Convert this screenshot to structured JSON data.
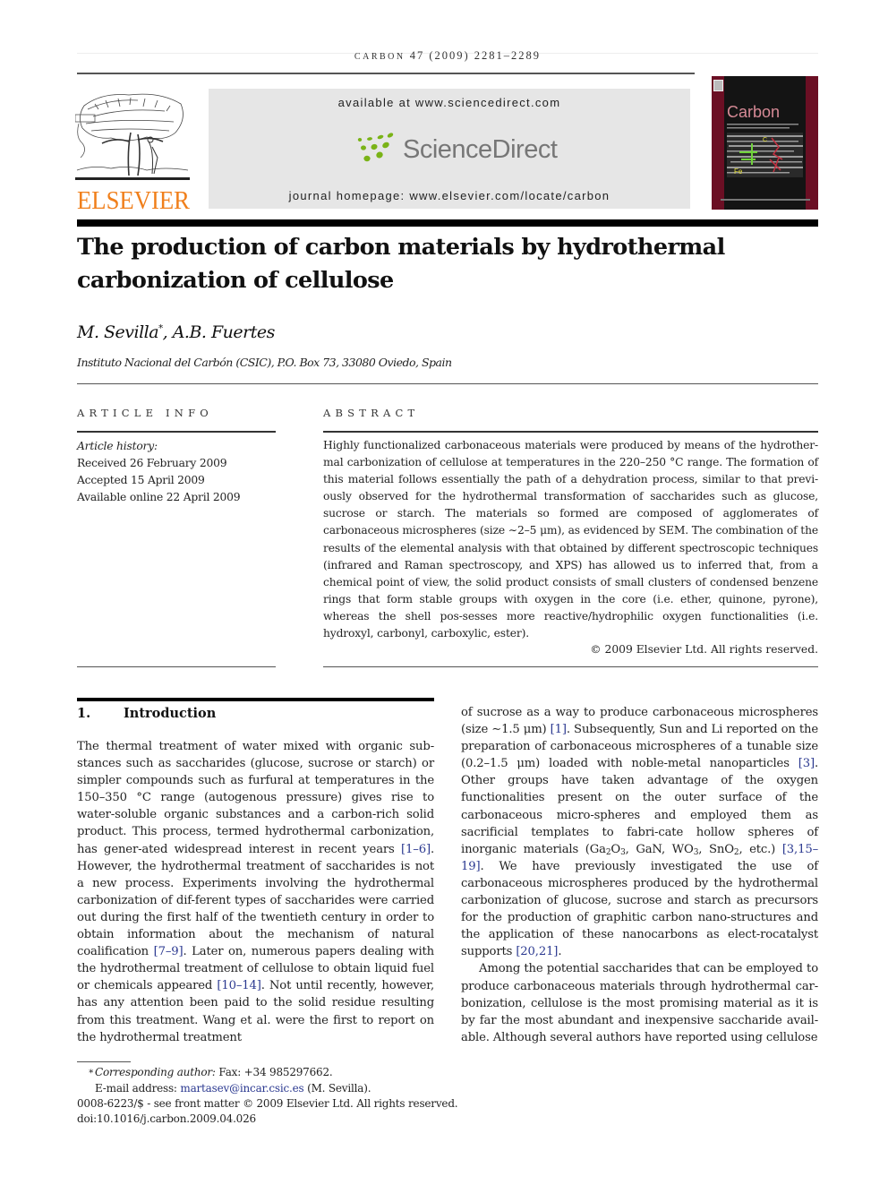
{
  "running_head": {
    "journal": "CARBON",
    "volume_issue_pages": "47 (2009) 2281–2289"
  },
  "publisher": {
    "name": "ELSEVIER",
    "logo_icon": "elsevier-tree-icon",
    "brand_color": "#f07f1b"
  },
  "banner": {
    "available_at": "available at www.sciencedirect.com",
    "sciencedirect_wordmark": "ScienceDirect",
    "sciencedirect_icon": "sciencedirect-dots-icon",
    "sciencedirect_green": "#7ab317",
    "journal_homepage": "journal homepage: www.elsevier.com/locate/carbon"
  },
  "cover": {
    "title": "Carbon",
    "cover_color": "#6b0f24"
  },
  "article": {
    "title": "The production of carbon materials by hydrothermal carbonization of cellulose",
    "authors": [
      {
        "name": "M. Sevilla",
        "mark": "*"
      },
      {
        "name": "A.B. Fuertes",
        "mark": ""
      }
    ],
    "author_separator": ", ",
    "affiliation": "Instituto Nacional del Carbón (CSIC), P.O. Box 73, 33080 Oviedo, Spain"
  },
  "article_info": {
    "heading": "ARTICLE INFO",
    "history_label": "Article history:",
    "received": "Received 26 February 2009",
    "accepted": "Accepted 15 April 2009",
    "available_online": "Available online 22 April 2009"
  },
  "abstract": {
    "heading": "ABSTRACT",
    "text": "Highly functionalized carbonaceous materials were produced by means of the hydrother-mal carbonization of cellulose at temperatures in the 220–250 °C range. The formation of this material follows essentially the path of a dehydration process, similar to that previ-ously observed for the hydrothermal transformation of saccharides such as glucose, sucrose or starch. The materials so formed are composed of agglomerates of carbonaceous microspheres (size ∼2–5 μm), as evidenced by SEM. The combination of the results of the elemental analysis with that obtained by different spectroscopic techniques (infrared and Raman spectroscopy, and XPS) has allowed us to inferred that, from a chemical point of view, the solid product consists of small clusters of condensed benzene rings that form stable groups with oxygen in the core (i.e. ether, quinone, pyrone), whereas the shell pos-sesses more reactive/hydrophilic oxygen functionalities (i.e. hydroxyl, carbonyl, carboxylic, ester).",
    "copyright": "© 2009 Elsevier Ltd. All rights reserved."
  },
  "section": {
    "number": "1.",
    "title": "Introduction"
  },
  "body": {
    "left": {
      "p1_a": "The thermal treatment of water mixed with organic sub-stances such as saccharides (glucose, sucrose or starch) or simpler compounds such as furfural at temperatures in the 150–350 °C range (autogenous pressure) gives rise to water-soluble organic substances and a carbon-rich solid product. This process, termed hydrothermal carbonization, has gener-ated widespread interest in recent years ",
      "ref1": "[1–6]",
      "p1_b": ". However, the hydrothermal treatment of saccharides is not a new process. Experiments involving the hydrothermal carbonization of dif-ferent types of saccharides were carried out during the first half of the twentieth century in order to obtain information about the mechanism of natural coalification ",
      "ref2": "[7–9]",
      "p1_c": ". Later on, numerous papers dealing with the hydrothermal treatment of cellulose to obtain liquid fuel or chemicals appeared ",
      "ref3": "[10–14]",
      "p1_d": ". Not until recently, however, has any attention been paid to the solid residue resulting from this treatment. Wang et al. were the first to report on the hydrothermal treatment"
    },
    "right": {
      "p1_a": "of sucrose as a way to produce carbonaceous microspheres (size ∼1.5 μm) ",
      "ref1": "[1]",
      "p1_b": ". Subsequently, Sun and Li reported on the preparation of carbonaceous microspheres of a tunable size (0.2–1.5 μm) loaded with noble-metal nanoparticles ",
      "ref2": "[3]",
      "p1_c": ". Other groups have taken advantage of the oxygen functionalities present on the outer surface of the carbonaceous micro-spheres and employed them as sacrificial templates to fabri-cate hollow spheres of inorganic materials (Ga",
      "ga_sub1": "2",
      "ga_o": "O",
      "ga_sub2": "3",
      "p1_d": ", GaN, WO",
      "wo_sub": "3",
      "p1_e": ", SnO",
      "sno_sub": "2",
      "p1_f": ", etc.) ",
      "ref3": "[3,15–19]",
      "p1_g": ". We have previously investigated the use of carbonaceous microspheres produced by the hydrothermal carbonization of glucose, sucrose and starch as precursors for the production of graphitic carbon nano-structures and the application of these nanocarbons as elect-rocatalyst supports ",
      "ref4": "[20,21]",
      "p1_h": ".",
      "p2": "Among the potential saccharides that can be employed to produce carbonaceous materials through hydrothermal car-bonization, cellulose is the most promising material as it is by far the most abundant and inexpensive saccharide avail-able. Although several authors have reported using cellulose"
    }
  },
  "footnotes": {
    "star": "*",
    "corresponding_label": "Corresponding author:",
    "fax": " Fax: +34 985297662.",
    "email_label": "E-mail address: ",
    "email": "martasev@incar.csic.es",
    "email_suffix": " (M. Sevilla).",
    "front_matter": "0008-6223/$ - see front matter © 2009 Elsevier Ltd. All rights reserved.",
    "doi": "doi:10.1016/j.carbon.2009.04.026"
  }
}
